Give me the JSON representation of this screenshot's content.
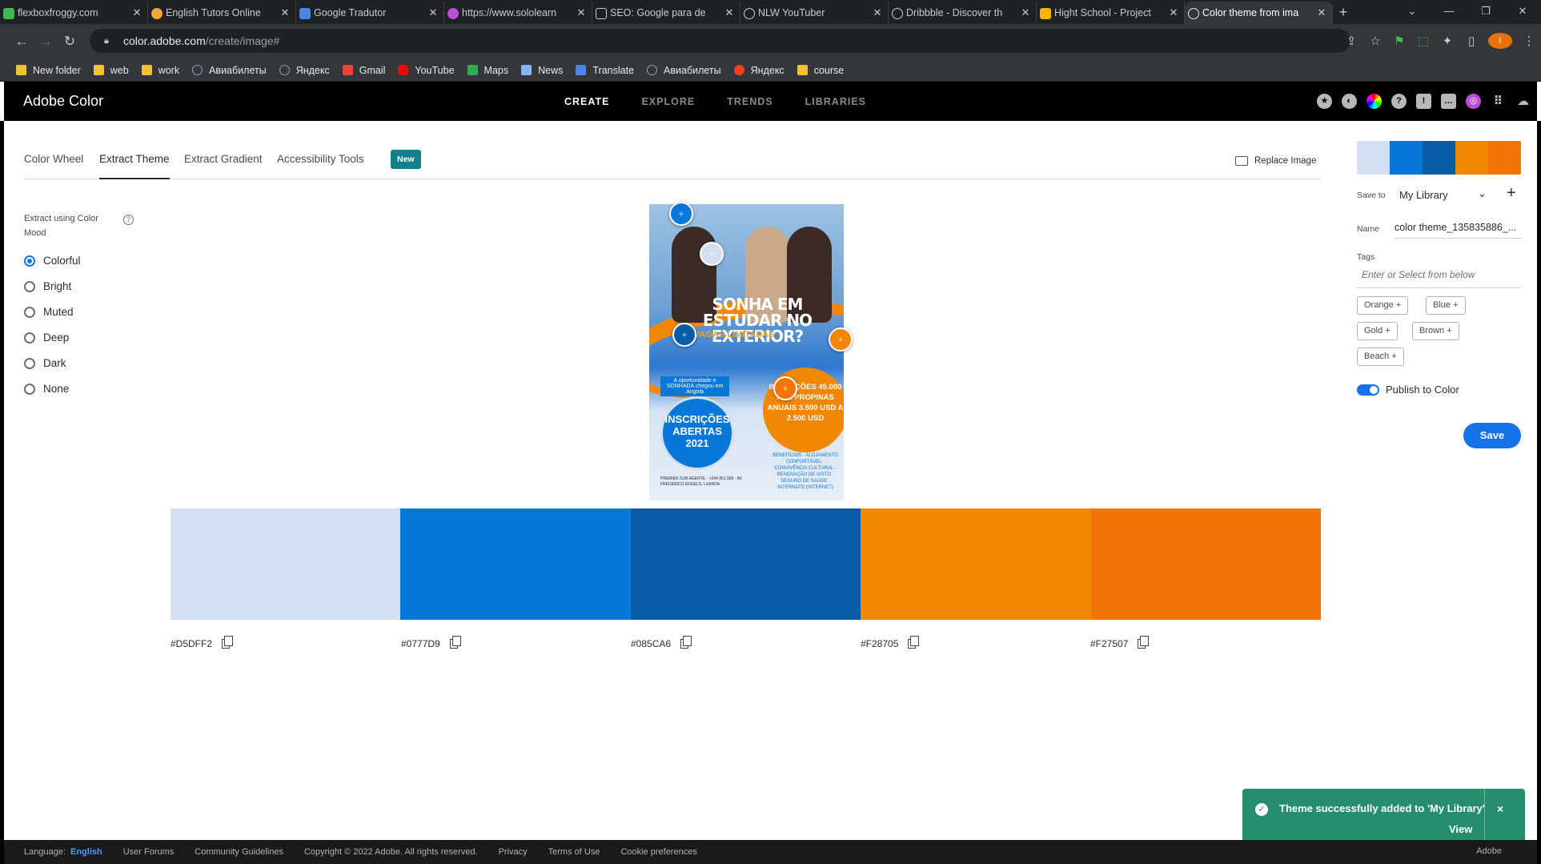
{
  "browser": {
    "tabs": [
      {
        "title": "flexboxfroggy.com",
        "icon_color": "#3fb950",
        "icon": "frog-icon"
      },
      {
        "title": "English Tutors Online",
        "icon_color": "#f2a53a",
        "icon": "site-icon"
      },
      {
        "title": "Google Tradutor",
        "icon_color": "#4a86e8",
        "icon": "translate-icon"
      },
      {
        "title": "https://www.sololearn",
        "icon_color": "#b84fd6",
        "icon": "sololearn-icon"
      },
      {
        "title": "SEO: Google para de",
        "icon_color": "#9aa0a6",
        "icon": "page-icon"
      },
      {
        "title": "NLW YouTuber",
        "icon_color": "#9aa0a6",
        "icon": "globe-icon"
      },
      {
        "title": "Dribbble - Discover th",
        "icon_color": "#9aa0a6",
        "icon": "globe-icon"
      },
      {
        "title": "Hight School - Project",
        "icon_color": "#f4b400",
        "icon": "fire-icon"
      },
      {
        "title": "Color theme from ima",
        "icon_color": "#e8eaed",
        "icon": "adobe-color-icon",
        "active": true
      }
    ],
    "new_tab": "+",
    "url_host": "color.adobe.com",
    "url_path": "/create/image#",
    "profile_initial": "I",
    "bookmarks": [
      {
        "label": "New folder",
        "icon": "folder-icon",
        "color": "#f1c232"
      },
      {
        "label": "web",
        "icon": "folder-icon",
        "color": "#f1c232"
      },
      {
        "label": "work",
        "icon": "folder-icon",
        "color": "#f1c232"
      },
      {
        "label": "Авиабилеты",
        "icon": "globe-icon",
        "color": "#9aa0a6"
      },
      {
        "label": "Яндекс",
        "icon": "globe-icon",
        "color": "#9aa0a6"
      },
      {
        "label": "Gmail",
        "icon": "gmail-icon",
        "color": "#ea4335"
      },
      {
        "label": "YouTube",
        "icon": "youtube-icon",
        "color": "#ff0000"
      },
      {
        "label": "Maps",
        "icon": "maps-icon",
        "color": "#34a853"
      },
      {
        "label": "News",
        "icon": "news-icon",
        "color": "#8ab4f8"
      },
      {
        "label": "Translate",
        "icon": "translate-icon",
        "color": "#4a86e8"
      },
      {
        "label": "Авиабилеты",
        "icon": "globe-icon",
        "color": "#9aa0a6"
      },
      {
        "label": "Яндекс",
        "icon": "yandex-icon",
        "color": "#fc3f1d"
      },
      {
        "label": "course",
        "icon": "folder-icon",
        "color": "#f1c232"
      }
    ]
  },
  "header": {
    "brand": "Adobe Color",
    "nav": [
      "CREATE",
      "EXPLORE",
      "TRENDS",
      "LIBRARIES"
    ]
  },
  "subtabs": {
    "items": [
      "Color Wheel",
      "Extract Theme",
      "Extract Gradient",
      "Accessibility Tools"
    ],
    "active": "Extract Theme",
    "badge": "New",
    "replace_image": "Replace Image"
  },
  "mood": {
    "label": "Extract using Color Mood",
    "options": [
      "Colorful",
      "Bright",
      "Muted",
      "Deep",
      "Dark",
      "None"
    ],
    "selected": "Colorful"
  },
  "poster": {
    "headline": "SONHA EM ESTUDAR NO EXTERIOR?",
    "sub": "VAGAS LIMITADAS",
    "small_banner": "A oportunidade e SONHADA chegou em Angola",
    "circle": "INSCRIÇÕES ABERTAS 2021",
    "orange_circle": "INSCRIÇÕES 45.000 AKZ PROPINAS ANUAIS 3.500 USD A 2.500 USD",
    "list": "BENEFÍCIOS · ALOJAMENTO CONFORTÁVEL · CONVIVÊNCIA CULTURAL · RENOVAÇÃO DE VISTO · SEGURO DE SAÚDE · INTERNATO (INTERNET)",
    "footer": "PREMIER SUB AGENTE · +244 951 000 · AV. FREDERICO ENGELS, LUANDA"
  },
  "swatches": [
    {
      "hex": "#D5DFF2",
      "color": "#D5DFF2"
    },
    {
      "hex": "#0777D9",
      "color": "#0777D9"
    },
    {
      "hex": "#085CA6",
      "color": "#085CA6"
    },
    {
      "hex": "#F28705",
      "color": "#F28705"
    },
    {
      "hex": "#F27507",
      "color": "#F27507"
    }
  ],
  "panel": {
    "save_to_label": "Save to",
    "library": "My Library",
    "name_label": "Name",
    "name_value": "color theme_135835886_...",
    "tags_label": "Tags",
    "tags_placeholder": "Enter or Select from below",
    "tags": [
      "Orange",
      "Blue",
      "Gold",
      "Brown",
      "Beach"
    ],
    "publish_label": "Publish to Color",
    "publish_on": true,
    "save_label": "Save"
  },
  "toast": {
    "message": "Theme successfully added to 'My Library'",
    "action": "View",
    "close": "×"
  },
  "footer": {
    "language_label": "Language:",
    "language": "English",
    "links": [
      "User Forums",
      "Community Guidelines",
      "Copyright © 2022 Adobe. All rights reserved.",
      "Privacy",
      "Terms of Use",
      "Cookie preferences"
    ],
    "adobe": "Adobe"
  }
}
